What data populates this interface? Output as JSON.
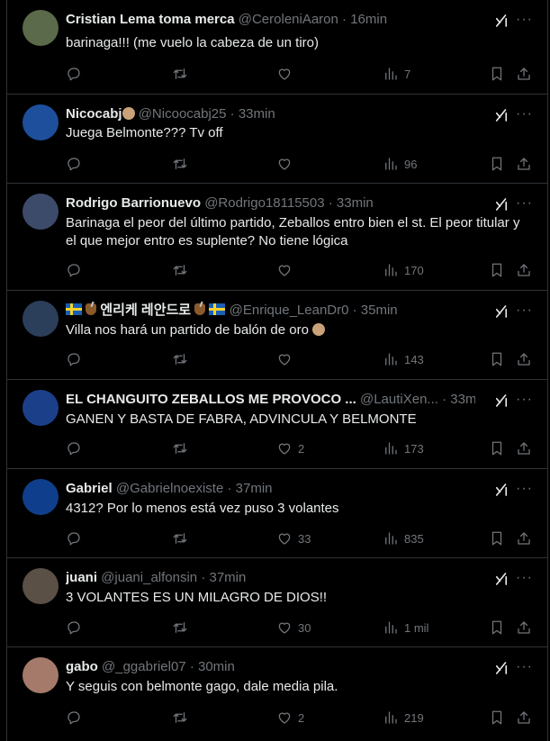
{
  "tweets": [
    {
      "name": "Cristian Lema toma merca",
      "handle": "@CeroleniAaron",
      "time": "16min",
      "text": [
        "barinaga!!! (me vuelo la cabeza de un tiro)"
      ],
      "replies": "",
      "retweets": "",
      "likes": "",
      "views": "7",
      "avatar_color": "#5a6a4a"
    },
    {
      "name": "Nicocabj",
      "handle": "@Nicoocabj25",
      "time": "33min",
      "text": [
        "Juega Belmonte??? Tv off"
      ],
      "replies": "",
      "retweets": "",
      "likes": "",
      "views": "96",
      "avatar_color": "#1d4f9c"
    },
    {
      "name": "Rodrigo Barrionuevo",
      "handle": "@Rodrigo18115503",
      "time": "33min",
      "text": [
        "Barinaga el peor del último partido, Zeballos entro bien el st. El peor titular y",
        "el que mejor entro es suplente? No tiene lógica"
      ],
      "replies": "",
      "retweets": "",
      "likes": "",
      "views": "170",
      "avatar_color": "#3c4b6a"
    },
    {
      "name": "엔리케 레안드로",
      "handle": "@Enrique_LeanDr0",
      "time": "35min",
      "text": [
        "Villa nos hará un partido de balón de oro"
      ],
      "replies": "",
      "retweets": "",
      "likes": "",
      "views": "143",
      "avatar_color": "#2b3e5a"
    },
    {
      "name": "EL CHANGUITO ZEBALLOS ME PROVOCO ...",
      "handle": "@LautiXen...",
      "time": "33min",
      "text": [
        "GANEN Y BASTA DE FABRA, ADVINCULA Y BELMONTE"
      ],
      "replies": "",
      "retweets": "",
      "likes": "2",
      "views": "173",
      "avatar_color": "#1c3f8a"
    },
    {
      "name": "Gabriel",
      "handle": "@Gabrielnoexiste",
      "time": "37min",
      "text": [
        "4312? Por lo menos está vez puso 3 volantes"
      ],
      "replies": "",
      "retweets": "",
      "likes": "33",
      "views": "835",
      "avatar_color": "#0f3f8c"
    },
    {
      "name": "juani",
      "handle": "@juani_alfonsin",
      "time": "37min",
      "text": [
        "3 VOLANTES ES UN MILAGRO DE DIOS!!"
      ],
      "replies": "",
      "retweets": "",
      "likes": "30",
      "views": "1 mil",
      "avatar_color": "#5b5045"
    },
    {
      "name": "gabo",
      "handle": "@_ggabriel07",
      "time": "30min",
      "text": [
        "Y seguis con belmonte gago, dale media pila."
      ],
      "replies": "",
      "retweets": "",
      "likes": "2",
      "views": "219",
      "avatar_color": "#a57a6a"
    }
  ],
  "icons": {
    "reply": "reply-icon",
    "retweet": "retweet-icon",
    "like": "like-icon",
    "views": "views-icon",
    "bookmark": "bookmark-icon",
    "share": "share-icon",
    "grok": "grok-icon",
    "more": "more-icon"
  },
  "colors": {
    "background": "#000000",
    "text": "#e7e9ea",
    "muted": "#71767b",
    "divider": "#2f3336"
  }
}
